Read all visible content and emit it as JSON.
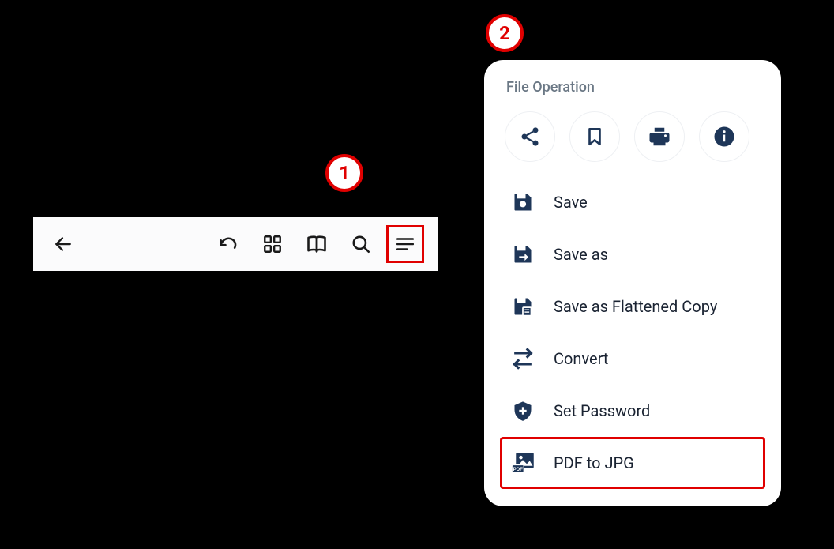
{
  "callouts": {
    "one": "1",
    "two": "2"
  },
  "panel": {
    "title": "File Operation",
    "menu": {
      "save": "Save",
      "save_as": "Save as",
      "save_flattened": "Save as Flattened Copy",
      "convert": "Convert",
      "set_password": "Set Password",
      "pdf_to_jpg": "PDF to JPG"
    }
  },
  "colors": {
    "accent": "#1e3658",
    "highlight": "#e00000",
    "muted": "#6b7885"
  }
}
